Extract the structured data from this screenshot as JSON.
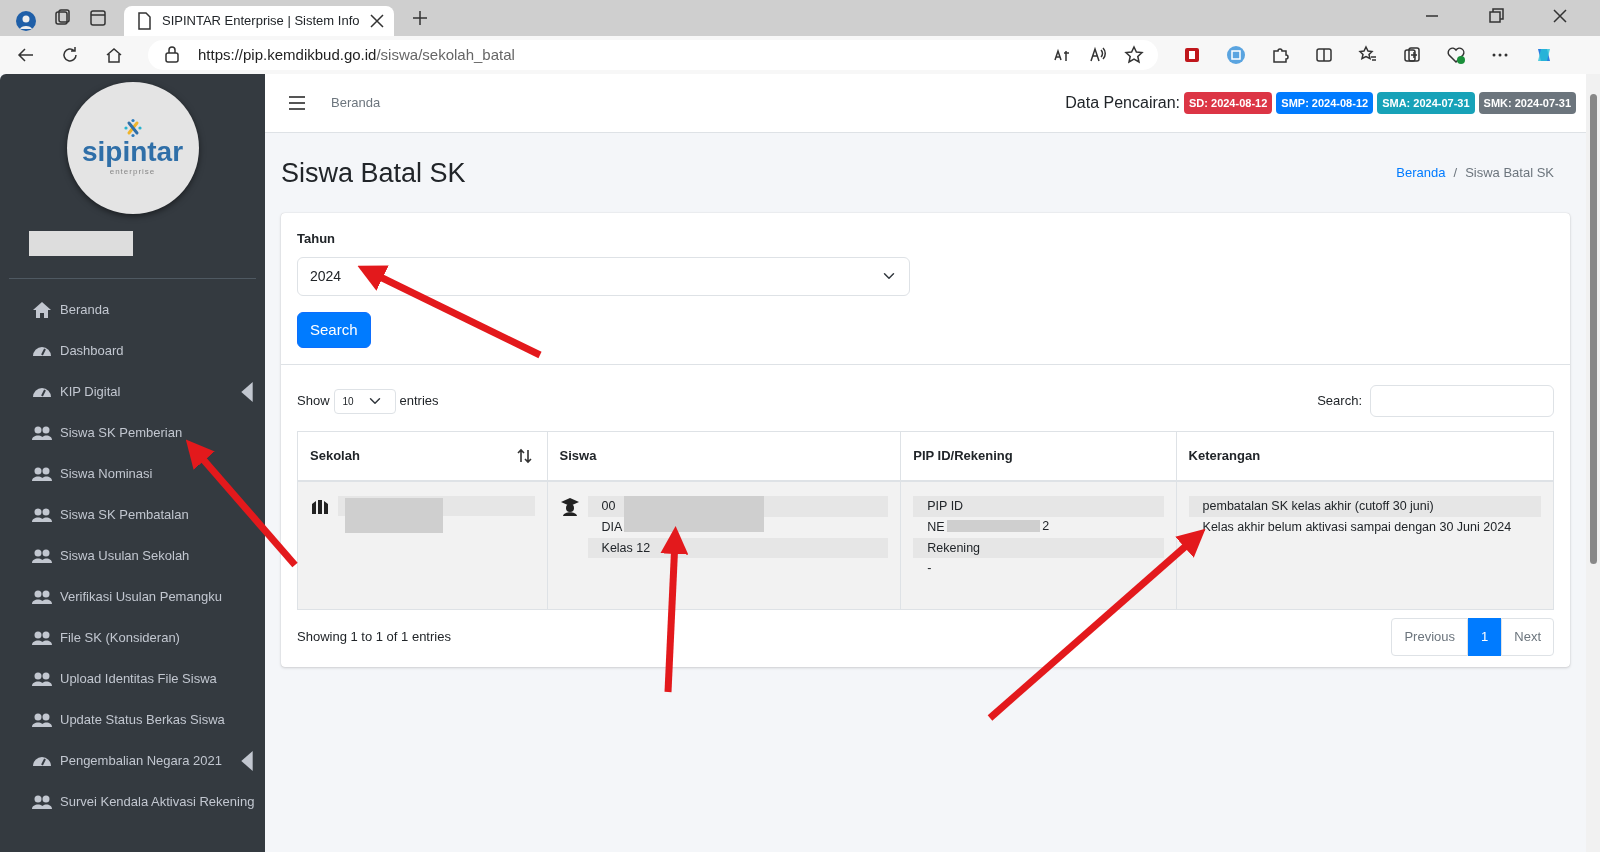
{
  "browser": {
    "tab_title": "SIPINTAR Enterprise | Sistem Info",
    "url_host": "https://pip.kemdikbud.go.id",
    "url_path": "/siswa/sekolah_batal"
  },
  "logo": {
    "name": "sipintar",
    "tagline": "enterprise"
  },
  "sidebar": {
    "items": [
      {
        "label": "Beranda",
        "kind": "home",
        "has_submenu": false
      },
      {
        "label": "Dashboard",
        "kind": "gauge",
        "has_submenu": false
      },
      {
        "label": "KIP Digital",
        "kind": "gauge",
        "has_submenu": true
      },
      {
        "label": "Siswa SK Pemberian",
        "kind": "users",
        "has_submenu": false
      },
      {
        "label": "Siswa Nominasi",
        "kind": "users",
        "has_submenu": false
      },
      {
        "label": "Siswa SK Pembatalan",
        "kind": "users",
        "has_submenu": false
      },
      {
        "label": "Siswa Usulan Sekolah",
        "kind": "users",
        "has_submenu": false
      },
      {
        "label": "Verifikasi Usulan Pemangku",
        "kind": "users",
        "has_submenu": false
      },
      {
        "label": "File SK (Konsideran)",
        "kind": "users",
        "has_submenu": false
      },
      {
        "label": "Upload Identitas File Siswa",
        "kind": "users",
        "has_submenu": false
      },
      {
        "label": "Update Status Berkas Siswa",
        "kind": "users",
        "has_submenu": false
      },
      {
        "label": "Pengembalian Negara 2021",
        "kind": "gauge",
        "has_submenu": true
      },
      {
        "label": "Survei Kendala Aktivasi Rekening",
        "kind": "users",
        "has_submenu": false
      }
    ]
  },
  "topbar": {
    "home_link": "Beranda",
    "pencairan_label": "Data Pencairan:",
    "badges": [
      {
        "text": "SD: 2024-08-12",
        "color": "#dc3545"
      },
      {
        "text": "SMP: 2024-08-12",
        "color": "#007bff"
      },
      {
        "text": "SMA: 2024-07-31",
        "color": "#17a2b8"
      },
      {
        "text": "SMK: 2024-07-31",
        "color": "#6c757d"
      }
    ]
  },
  "page": {
    "title": "Siswa Batal SK",
    "breadcrumb_separator": "/",
    "breadcrumb": [
      {
        "label": "Beranda",
        "link": true
      },
      {
        "label": "Siswa Batal SK",
        "link": false
      }
    ]
  },
  "filter": {
    "label": "Tahun",
    "value": "2024",
    "button": "Search"
  },
  "table_controls": {
    "show_label": "Show",
    "page_size": "10",
    "entries_label": "entries",
    "search_label": "Search:"
  },
  "table": {
    "columns": [
      {
        "label": "Sekolah",
        "sortable": true
      },
      {
        "label": "Siswa",
        "sortable": false
      },
      {
        "label": "PIP ID/Rekening",
        "sortable": false
      },
      {
        "label": "Keterangan",
        "sortable": false
      }
    ],
    "rows": [
      {
        "siswa": {
          "lines": [
            "00",
            "DIA",
            "Kelas 12"
          ]
        },
        "pip": {
          "lines": [
            "PIP ID",
            "NE",
            "Rekening",
            "-"
          ],
          "after_redaction": "2"
        },
        "keterangan": {
          "lines": [
            "pembatalan SK kelas akhir (cutoff 30 juni)",
            "Kelas akhir belum aktivasi sampai dengan 30 Juni 2024"
          ]
        }
      }
    ]
  },
  "footer": {
    "info": "Showing 1 to 1 of 1 entries",
    "pages": [
      {
        "label": "Previous",
        "kind": "prev",
        "selected": false
      },
      {
        "label": "1",
        "kind": "page",
        "selected": true
      },
      {
        "label": "Next",
        "kind": "next",
        "selected": false
      }
    ]
  }
}
